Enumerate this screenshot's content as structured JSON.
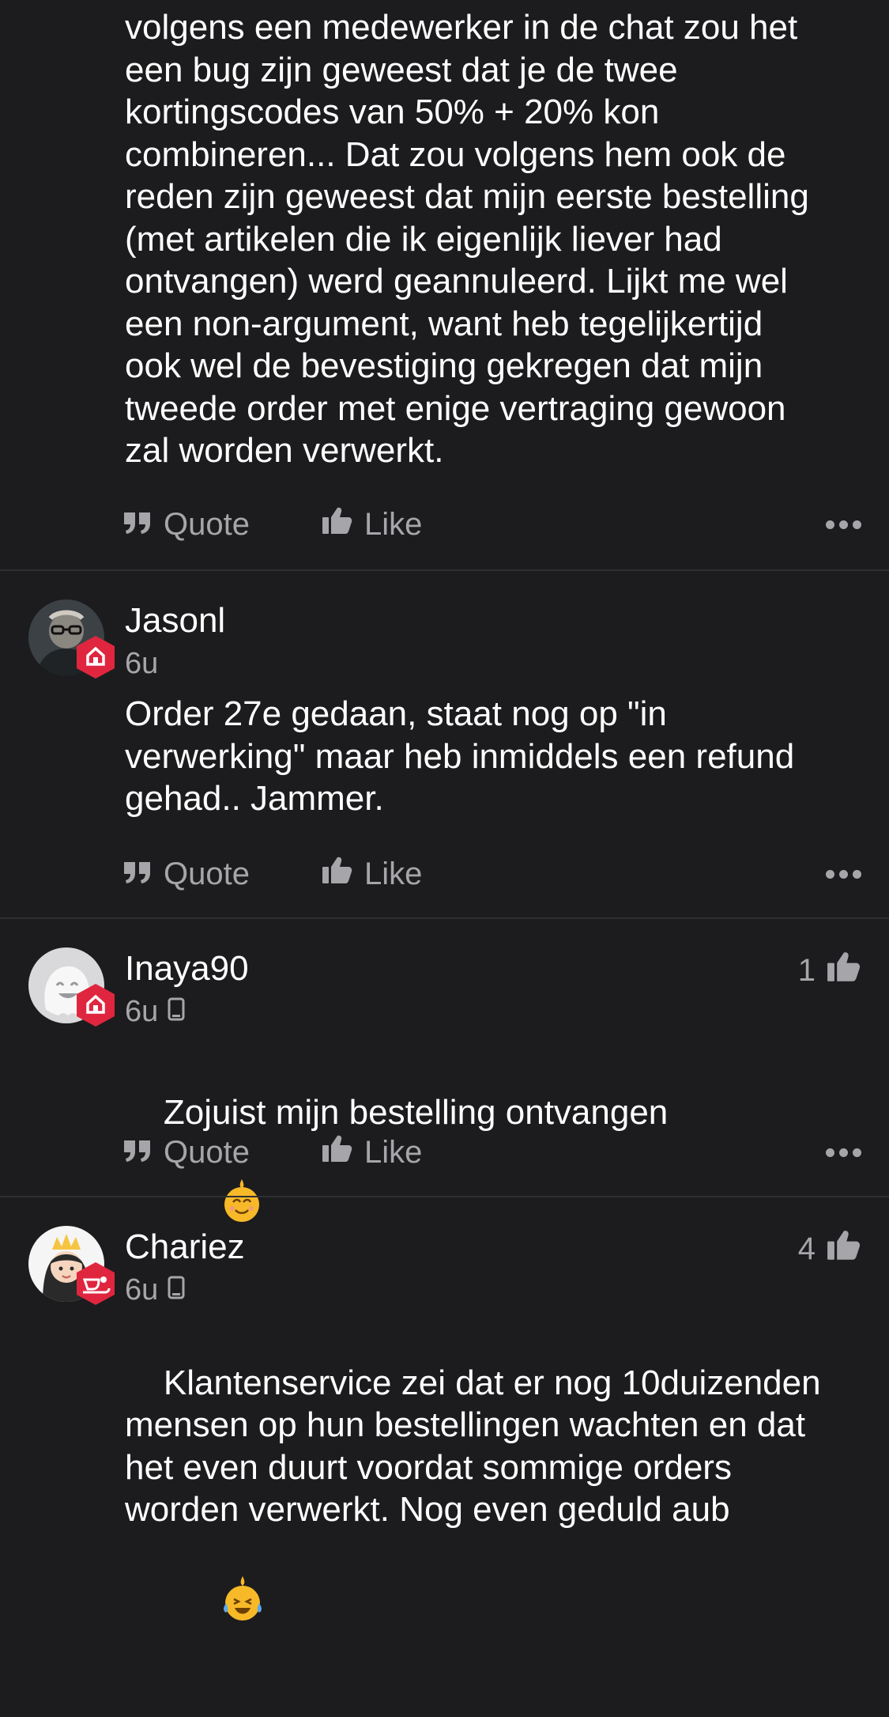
{
  "posts": [
    {
      "body": "volgens een medewerker in de chat zou het\neen bug zijn geweest dat je de twee\nkortingscodes van 50% + 20% kon\ncombineren... Dat zou volgens hem ook de\nreden zijn geweest dat mijn eerste bestelling\n(met artikelen die ik eigenlijk liever had\nontvangen) werd geannuleerd. Lijkt me wel\neen non-argument, want heb tegelijkertijd\nook wel de bevestiging gekregen dat mijn\ntweede order met enige vertraging gewoon\nzal worden verwerkt.",
      "quote_label": "Quote",
      "like_label": "Like"
    },
    {
      "username": "Jasonl",
      "time": "6u",
      "body": "Order 27e gedaan, staat nog op \"in\nverwerking\" maar heb inmiddels een refund\ngehad.. Jammer.",
      "quote_label": "Quote",
      "like_label": "Like",
      "avatar_icon": "user-avatar-glasses",
      "badge_icon": "house-badge-icon"
    },
    {
      "username": "Inaya90",
      "time": "6u",
      "likes": "1",
      "body": "Zojuist mijn bestelling ontvangen",
      "emoji": "smiling-face-emoji",
      "quote_label": "Quote",
      "like_label": "Like",
      "avatar_icon": "ghost-avatar",
      "badge_icon": "house-badge-icon"
    },
    {
      "username": "Chariez",
      "time": "6u",
      "likes": "4",
      "body": "Klantenservice zei dat er nog 10duizenden\nmensen op hun bestellingen wachten en dat\nhet even duurt voordat sommige orders\nworden verwerkt. Nog even geduld aub",
      "emoji": "laughing-tears-emoji",
      "avatar_icon": "princess-avatar",
      "badge_icon": "sleigh-badge-icon"
    }
  ],
  "colors": {
    "background": "#1c1c1e",
    "text": "#ffffff",
    "muted": "#a6a6aa",
    "divider": "#2f2f31",
    "badge_red": "#e0263f",
    "emoji_yellow": "#f7b928"
  }
}
